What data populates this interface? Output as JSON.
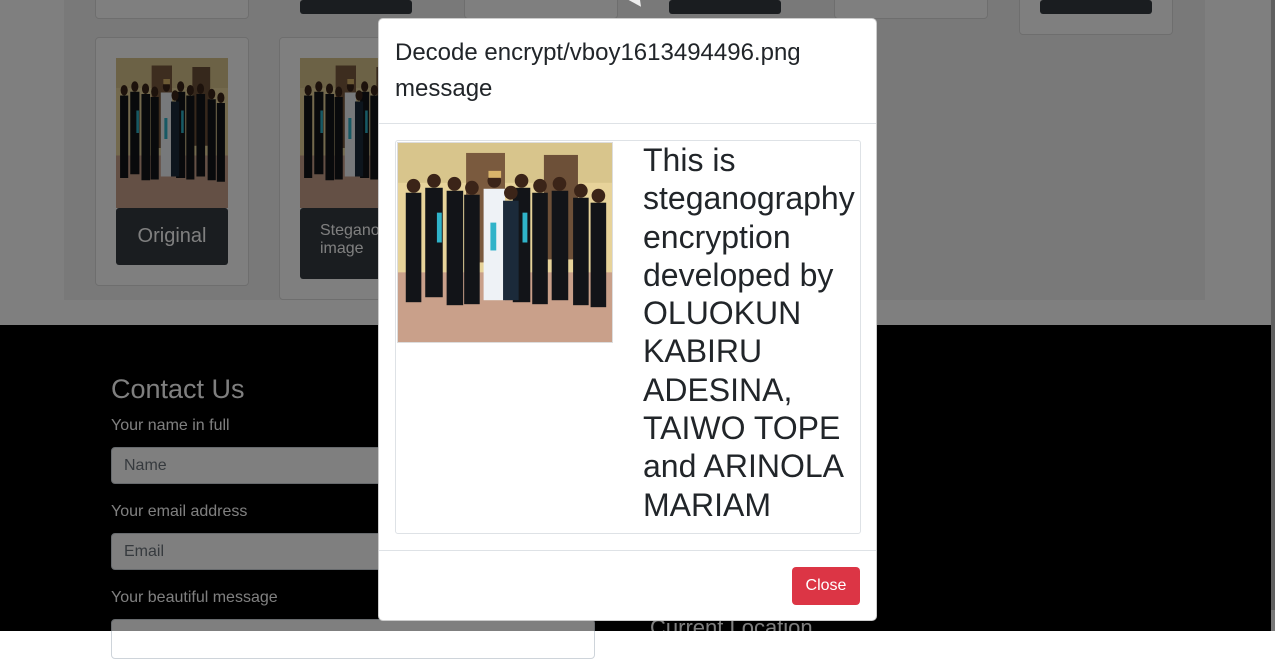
{
  "gallery": {
    "cards": [
      {
        "caption": "Original"
      },
      {
        "caption": "Steganography image"
      }
    ]
  },
  "footer": {
    "contact_title": "Contact Us",
    "name_label": "Your name in full",
    "name_placeholder": "Name",
    "email_label": "Your email address",
    "email_placeholder": "Email",
    "message_label": "Your beautiful message",
    "location_title": "Current Location"
  },
  "modal": {
    "title": "Decode encrypt/vboy1613494496.png message",
    "message": "This is steganography encryption developed by OLUOKUN KABIRU ADESINA, TAIWO TOPE and ARINOLA MARIAM",
    "close_label": "Close"
  },
  "colors": {
    "close_button": "#dc3545",
    "dark_button": "#343a40",
    "footer_bg": "#000000"
  }
}
